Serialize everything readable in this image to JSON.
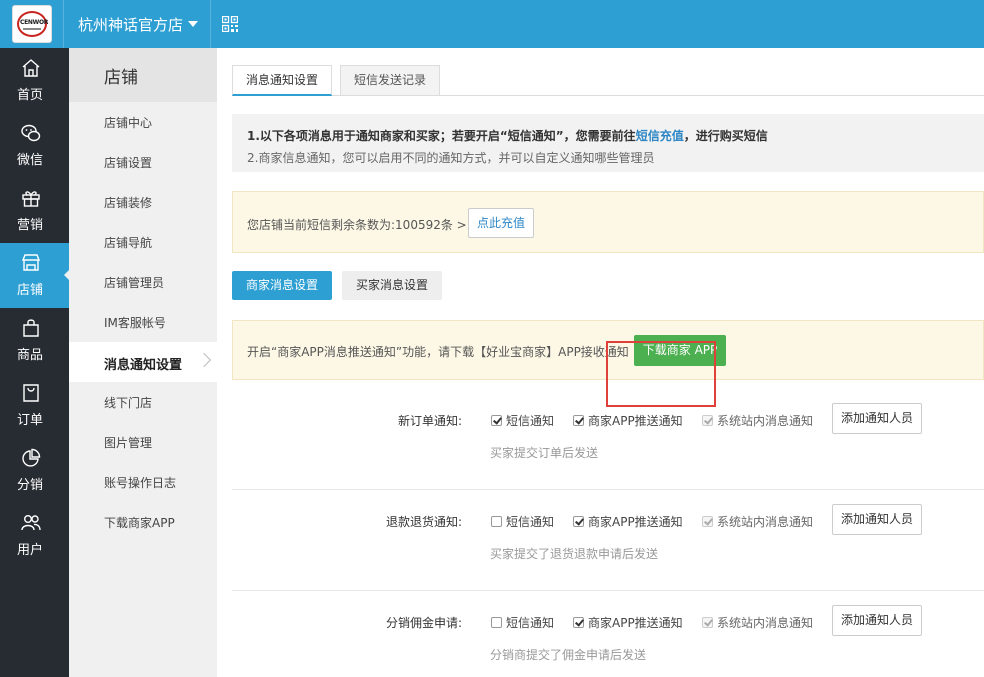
{
  "header": {
    "logo_text": "CENWOR",
    "store_name": "杭州神话官方店"
  },
  "leftnav": [
    {
      "label": "首页",
      "icon": "home-icon"
    },
    {
      "label": "微信",
      "icon": "wechat-icon"
    },
    {
      "label": "营销",
      "icon": "gift-icon"
    },
    {
      "label": "店铺",
      "icon": "store-icon",
      "active": true
    },
    {
      "label": "商品",
      "icon": "bag-icon"
    },
    {
      "label": "订单",
      "icon": "order-icon"
    },
    {
      "label": "分销",
      "icon": "pie-icon"
    },
    {
      "label": "用户",
      "icon": "users-icon"
    }
  ],
  "subnav": {
    "title": "店铺",
    "items": [
      "店铺中心",
      "店铺设置",
      "店铺装修",
      "店铺导航",
      "店铺管理员",
      "IM客服帐号",
      "消息通知设置",
      "线下门店",
      "图片管理",
      "账号操作日志",
      "下载商家APP"
    ],
    "active_index": 6
  },
  "tabs": [
    "消息通知设置",
    "短信发送记录"
  ],
  "notice": {
    "line1_prefix": "1.以下各项消息用于通知商家和买家；若要开启“短信通知”，您需要前往",
    "line1_link": "短信充值",
    "line1_suffix": "，进行购买短信",
    "line2": "2.商家信息通知，您可以启用不同的通知方式，并可以自定义通知哪些管理员"
  },
  "sms": {
    "text": "您店铺当前短信剩余条数为:100592条 >>",
    "button": "点此充值"
  },
  "segments": {
    "merchant": "商家消息设置",
    "buyer": "买家消息设置"
  },
  "app_notice": {
    "text": "开启“商家APP消息推送通知”功能，请下载【好业宝商家】APP接收通知",
    "button": "下载商家 APP"
  },
  "option_labels": {
    "sms": "短信通知",
    "app": "商家APP推送通知",
    "system": "系统站内消息通知"
  },
  "add_button": "添加通知人员",
  "rows": [
    {
      "label": "新订单通知:",
      "sms": true,
      "app": true,
      "system": true,
      "hint": "买家提交订单后发送"
    },
    {
      "label": "退款退货通知:",
      "sms": false,
      "app": true,
      "system": true,
      "hint": "买家提交了退货退款申请后发送"
    },
    {
      "label": "分销佣金申请:",
      "sms": false,
      "app": true,
      "system": true,
      "hint": "分销商提交了佣金申请后发送"
    }
  ],
  "colors": {
    "primary": "#2d9fd3",
    "nav_bg": "#272c33",
    "green": "#4caf50",
    "highlight": "#e0403a"
  }
}
